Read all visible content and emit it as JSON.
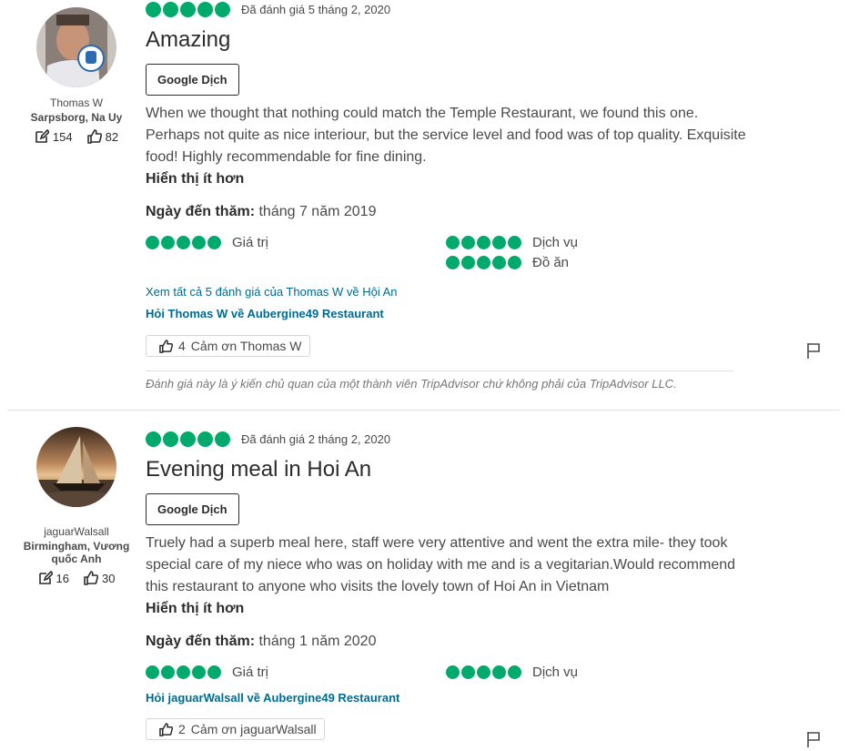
{
  "reviews": [
    {
      "member": {
        "username": "Thomas W",
        "hometown": "Sarpsborg, Na Uy",
        "review_count": "154",
        "helpful_count": "82"
      },
      "rating_label": "Đã đánh giá 5 tháng 2, 2020",
      "title": "Amazing",
      "translate_label": "Google Dịch",
      "body": "When we thought that nothing could match the Temple Restaurant, we found this one. Perhaps not quite as nice interiour, but the service level and food was of top quality. Exquisite food! Highly recommendable for fine dining.",
      "show_less": "Hiển thị ít hơn",
      "visit_label": "Ngày đến thăm:",
      "visit_date": "tháng 7 năm 2019",
      "subratings": [
        "Giá trị",
        "Dịch vụ",
        "Đồ ăn"
      ],
      "all_reviews_link": "Xem tất cả 5 đánh giá của Thomas W về Hội An",
      "ask_link": "Hỏi Thomas W về Aubergine49 Restaurant",
      "thank_count": "4",
      "thank_label": "Cảm ơn Thomas W",
      "disclaimer": "Đánh giá này là ý kiến chủ quan của một thành viên TripAdvisor chứ không phải của TripAdvisor LLC."
    },
    {
      "member": {
        "username": "jaguarWalsall",
        "hometown": "Birmingham, Vương quốc Anh",
        "review_count": "16",
        "helpful_count": "30"
      },
      "rating_label": "Đã đánh giá 2 tháng 2, 2020",
      "title": "Evening meal in Hoi An",
      "translate_label": "Google Dịch",
      "body": "Truely had a superb meal here, staff were very attentive and went the extra mile- they took special care of my niece who was on holiday with me and is a vegitarian.Would recommend this restaurant to anyone who visits the lovely town of Hoi An in Vietnam",
      "show_less": "Hiển thị ít hơn",
      "visit_label": "Ngày đến thăm:",
      "visit_date": "tháng 1 năm 2020",
      "subratings": [
        "Giá trị",
        "Dịch vụ"
      ],
      "ask_link": "Hỏi jaguarWalsall về Aubergine49 Restaurant",
      "thank_count": "2",
      "thank_label": "Cảm ơn jaguarWalsall"
    }
  ],
  "ratings": {
    "overall": 5,
    "max": 5
  },
  "colors": {
    "bubble": "#00aa6c",
    "link": "#006a8f"
  },
  "icons": {
    "review_count": "pencil-icon",
    "helpful": "thumbs-up-icon",
    "flag": "flag-icon"
  }
}
